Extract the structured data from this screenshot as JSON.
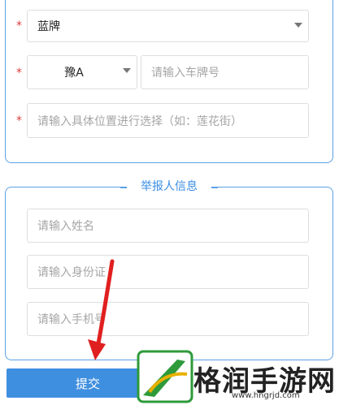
{
  "form": {
    "plate_color": {
      "value": "蓝牌"
    },
    "plate_prefix": {
      "value": "豫A"
    },
    "plate_number": {
      "placeholder": "请输入车牌号"
    },
    "location": {
      "placeholder": "请输入具体位置进行选择（如：莲花街）"
    },
    "required_mark": "*"
  },
  "reporter": {
    "section_title": "举报人信息",
    "name": {
      "placeholder": "请输入姓名"
    },
    "id_card": {
      "placeholder": "请输入身份证"
    },
    "phone": {
      "placeholder": "请输入手机号"
    }
  },
  "submit_label": "提交",
  "watermark": {
    "brand": "格润手游网",
    "url": "www.hngrjd.com"
  },
  "colors": {
    "accent": "#3f8fe0",
    "required": "#e03b3b",
    "arrow": "#e02020"
  }
}
